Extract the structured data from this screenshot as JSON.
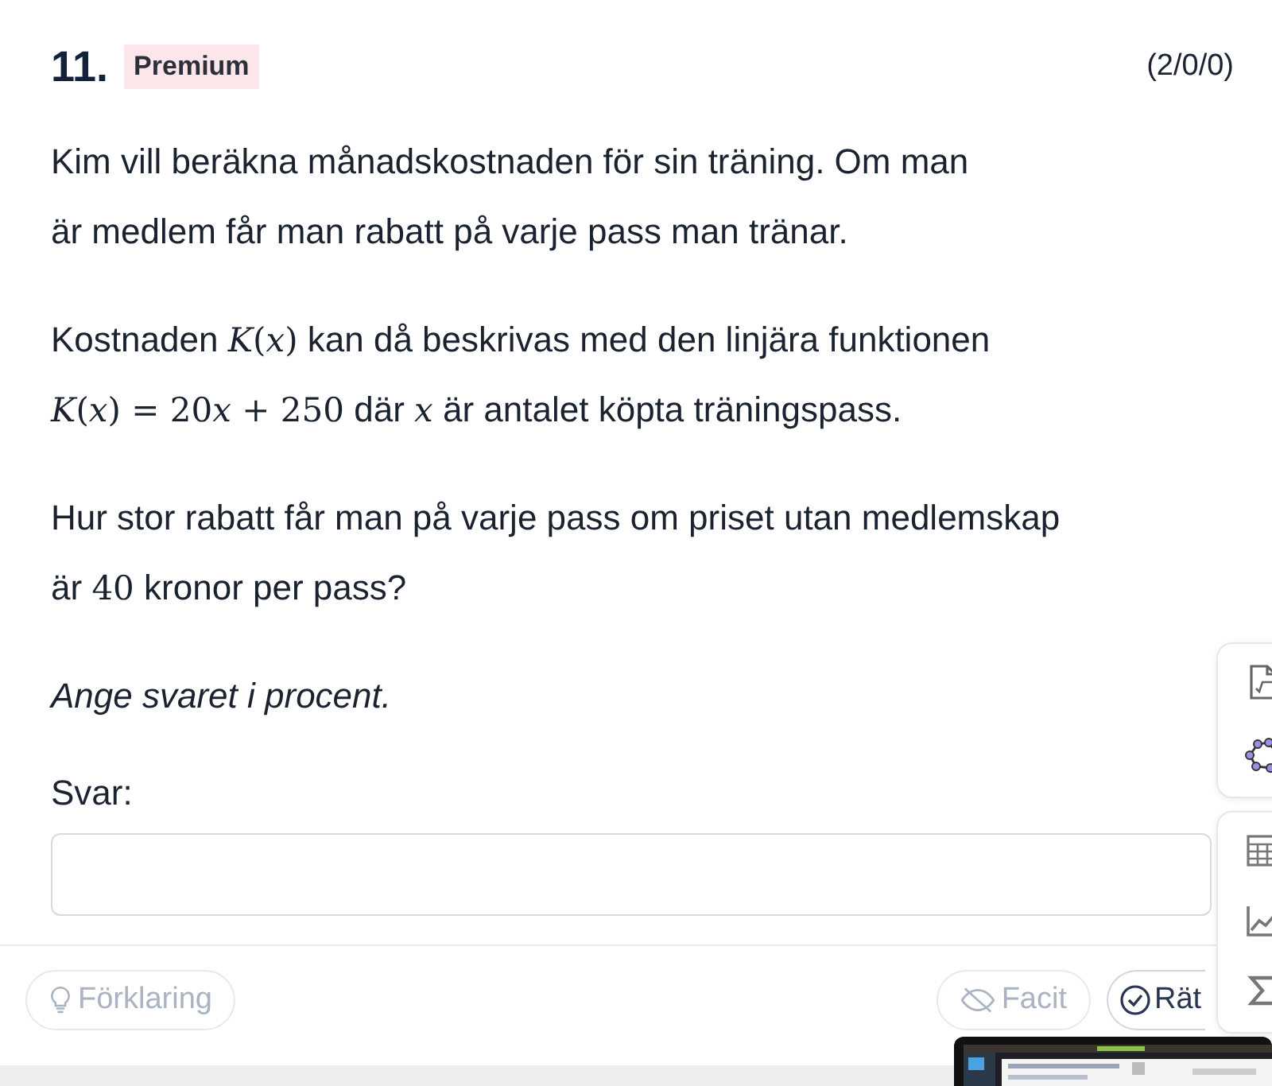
{
  "question": {
    "number": "11.",
    "badge": "Premium",
    "points": "(2/0/0)"
  },
  "paragraphs": [
    {
      "kind": "plain",
      "lines": [
        [
          {
            "kind": "text",
            "text": "Kim vill beräkna månadskostnaden för sin träning. Om man"
          }
        ],
        [
          {
            "kind": "text",
            "text": "är medlem får man rabatt på varje pass man tränar."
          }
        ]
      ]
    },
    {
      "kind": "plain",
      "lines": [
        [
          {
            "kind": "text",
            "text": "Kostnaden "
          },
          {
            "kind": "math",
            "text": "*K*(*x*)"
          },
          {
            "kind": "text",
            "text": " kan då beskrivas med den linjära funktionen"
          }
        ],
        [
          {
            "kind": "math",
            "text": "*K*(*x*) = 20"
          },
          {
            "kind": "math",
            "text": "*x*"
          },
          {
            "kind": "math",
            "text": " + 250"
          },
          {
            "kind": "text",
            "text": " där "
          },
          {
            "kind": "math",
            "text": "*x*"
          },
          {
            "kind": "text",
            "text": " är antalet köpta träningspass."
          }
        ]
      ]
    },
    {
      "kind": "plain",
      "lines": [
        [
          {
            "kind": "text",
            "text": "Hur stor rabatt får man på varje pass om priset utan medlemskap"
          }
        ],
        [
          {
            "kind": "text",
            "text": "är "
          },
          {
            "kind": "math",
            "text": "40"
          },
          {
            "kind": "text",
            "text": " kronor per pass?"
          }
        ]
      ]
    },
    {
      "kind": "italic",
      "lines": [
        [
          {
            "kind": "text",
            "text": "Ange svaret i procent."
          }
        ]
      ]
    }
  ],
  "answer": {
    "label": "Svar:"
  },
  "buttons": [
    {
      "kind": "explain",
      "label": "Förklaring",
      "disabled": true
    },
    {
      "kind": "facit",
      "label": "Facit",
      "disabled": true
    },
    {
      "kind": "check",
      "label": "Rät",
      "disabled": false
    }
  ]
}
